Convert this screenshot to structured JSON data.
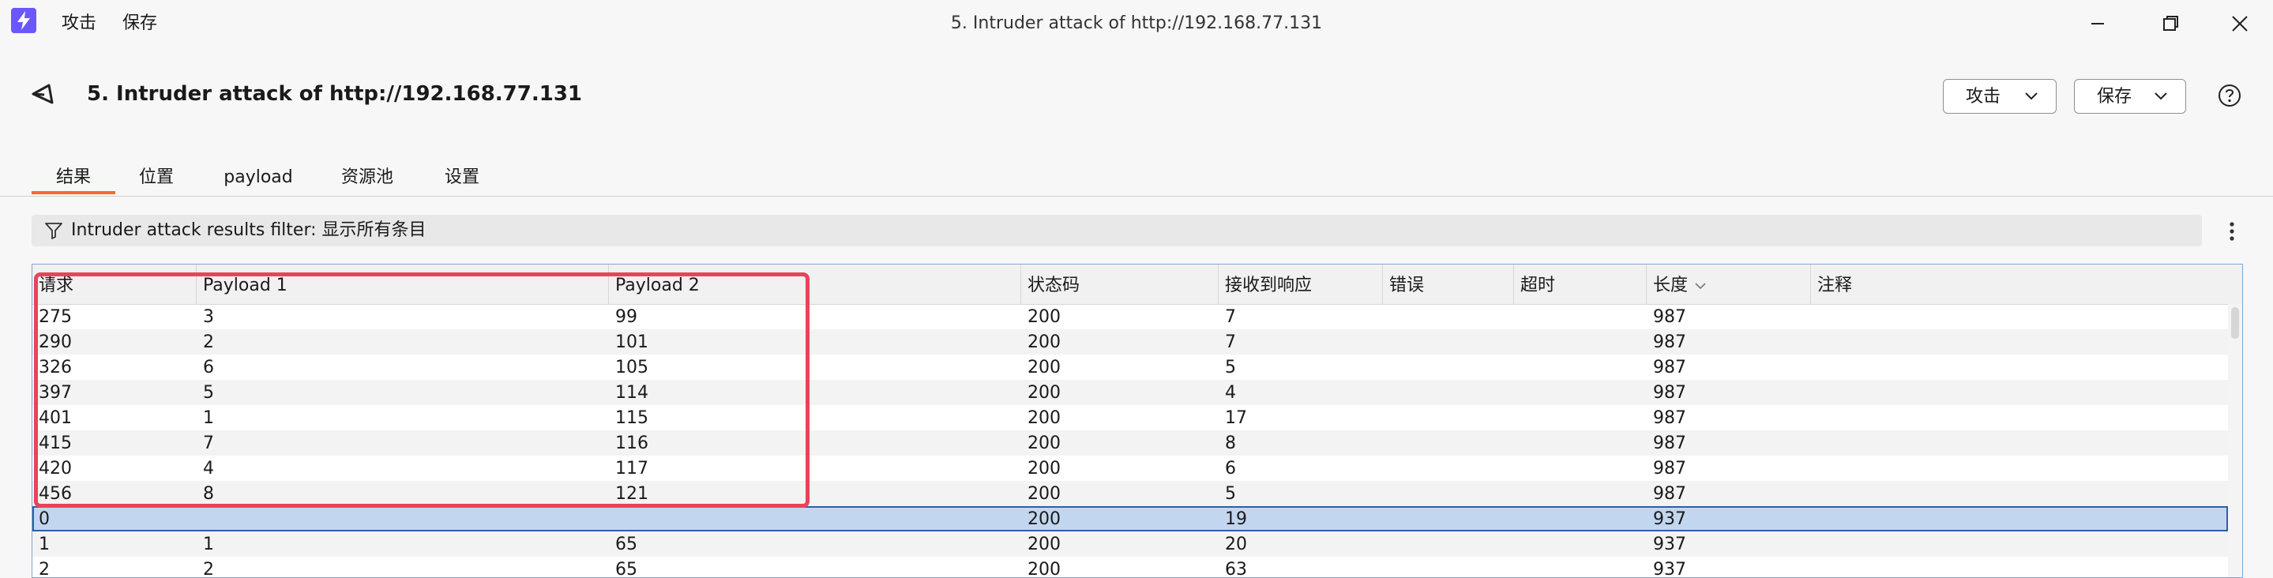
{
  "window": {
    "menu": [
      "攻击",
      "保存"
    ],
    "title": "5. Intruder attack of http://192.168.77.131"
  },
  "header": {
    "title": "5. Intruder attack of http://192.168.77.131",
    "attack_button": "攻击",
    "save_button": "保存"
  },
  "tabs": [
    "结果",
    "位置",
    "payload",
    "资源池",
    "设置"
  ],
  "active_tab": "结果",
  "filter": {
    "text": "Intruder attack results filter: 显示所有条目"
  },
  "table": {
    "columns": [
      "请求",
      "Payload 1",
      "Payload 2",
      "状态码",
      "接收到响应",
      "错误",
      "超时",
      "长度",
      "注释"
    ],
    "sorted_column": "长度",
    "rows": [
      [
        "275",
        "3",
        "99",
        "200",
        "7",
        "",
        "",
        "987",
        ""
      ],
      [
        "290",
        "2",
        "101",
        "200",
        "7",
        "",
        "",
        "987",
        ""
      ],
      [
        "326",
        "6",
        "105",
        "200",
        "5",
        "",
        "",
        "987",
        ""
      ],
      [
        "397",
        "5",
        "114",
        "200",
        "4",
        "",
        "",
        "987",
        ""
      ],
      [
        "401",
        "1",
        "115",
        "200",
        "17",
        "",
        "",
        "987",
        ""
      ],
      [
        "415",
        "7",
        "116",
        "200",
        "8",
        "",
        "",
        "987",
        ""
      ],
      [
        "420",
        "4",
        "117",
        "200",
        "6",
        "",
        "",
        "987",
        ""
      ],
      [
        "456",
        "8",
        "121",
        "200",
        "5",
        "",
        "",
        "987",
        ""
      ],
      [
        "0",
        "",
        "",
        "200",
        "19",
        "",
        "",
        "937",
        ""
      ],
      [
        "1",
        "1",
        "65",
        "200",
        "20",
        "",
        "",
        "937",
        ""
      ],
      [
        "2",
        "2",
        "65",
        "200",
        "63",
        "",
        "",
        "937",
        ""
      ]
    ],
    "selected_row": 8
  },
  "colors": {
    "accent": "#ff6633",
    "highlight": "#e9435b",
    "selection": "#c3d6ef",
    "logo": "#6b57ff"
  }
}
